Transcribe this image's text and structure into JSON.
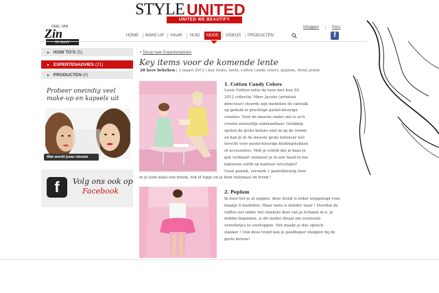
{
  "brand": {
    "style": "STYLE",
    "united": "UNITED",
    "tagline": "UNITED WE BEAUTIFY"
  },
  "logo": {
    "small": "DEEL VAN",
    "zin": "Zin",
    "bar": "in meer"
  },
  "top_links": {
    "login": "Inloggen",
    "separator": "|",
    "pers": "Pers"
  },
  "nav": {
    "items": [
      {
        "label": "HOME"
      },
      {
        "label": "MAKE-UP"
      },
      {
        "label": "HAAR"
      },
      {
        "label": "HUID"
      },
      {
        "label": "MODE"
      },
      {
        "label": "VIDEOS"
      },
      {
        "label": "PRODUCTEN"
      }
    ],
    "active": "MODE"
  },
  "sidebar": {
    "items": [
      {
        "label": "HOW TO'S",
        "count": "(5)"
      },
      {
        "label": "EXPERTENADVIES",
        "count": "(21)"
      },
      {
        "label": "PRODUCTEN",
        "count": "(0)"
      }
    ]
  },
  "promo1": {
    "text": "Probeer oneindig veel make-up en kapsels uit",
    "cta": "Wat wordt jouw nieuwe look?"
  },
  "promo2": {
    "title": "Volg ons ook op",
    "sub": "Facebook"
  },
  "article": {
    "breadcrumb": "Terug naar Expertenadvies",
    "title": "Key items voor de komende lente",
    "views": "28 keer bekeken",
    "meta_rest": " | 1 maart 2012 | key items, lente, cotton candy colors, peplum, floral prints",
    "sections": [
      {
        "heading": "1. Cotton Candy Colors",
        "lines": [
          "Louis Vuitton zette de toon met hun SS",
          "2012 collectie. Marc Jacobs (artistiek",
          "directeur) stuurde zijn modellen de catwalk",
          "op gehuld in prachtige pastel-kleurige",
          "creaties. Voor de meeste onder ons is zo'n",
          "creatie natuurlijk onbetaalbaar. Gelukkig",
          "spelen de grote ketens snel in op de trends",
          "en kan je in de meeste grote ketenser wel",
          "terecht voor pastel-kleurige kledingstukken",
          "of accessoires. Heb je schrik dat je baas je",
          "gek verklaart wanneer je in een head-to-toe",
          "babyroze outfit op kantoor verschijnt?",
          "Geen paniek, verwerk 1 pastelkleurig item",
          "in je look zoals een broek, rok of topje en je bent helemaal on trend !"
        ]
      },
      {
        "heading": "2. Peplum",
        "lines": [
          "Ik hoor het je al zeggen: deze trend is enkel weggelegd voor",
          "maatje 0 modellen. Maar niets is minder waar ! Doordat de",
          "ruffles net onder het slankste deel van je lichaam m.n. je",
          "middel beginnen, is dit model ideaal om eventuele",
          "vetrolletjes te verstoppen. Het maakt je dus optisch",
          "slanker ! Ook deze trend kan je goedkoper shoppen bij de",
          "grote ketens!"
        ]
      }
    ]
  },
  "colors": {
    "accent": "#cc1111",
    "facebook": "#3b5998",
    "sidebar_bg": "#e8e8e8"
  },
  "icons": {
    "search": "search-icon",
    "facebook": "facebook-icon"
  }
}
